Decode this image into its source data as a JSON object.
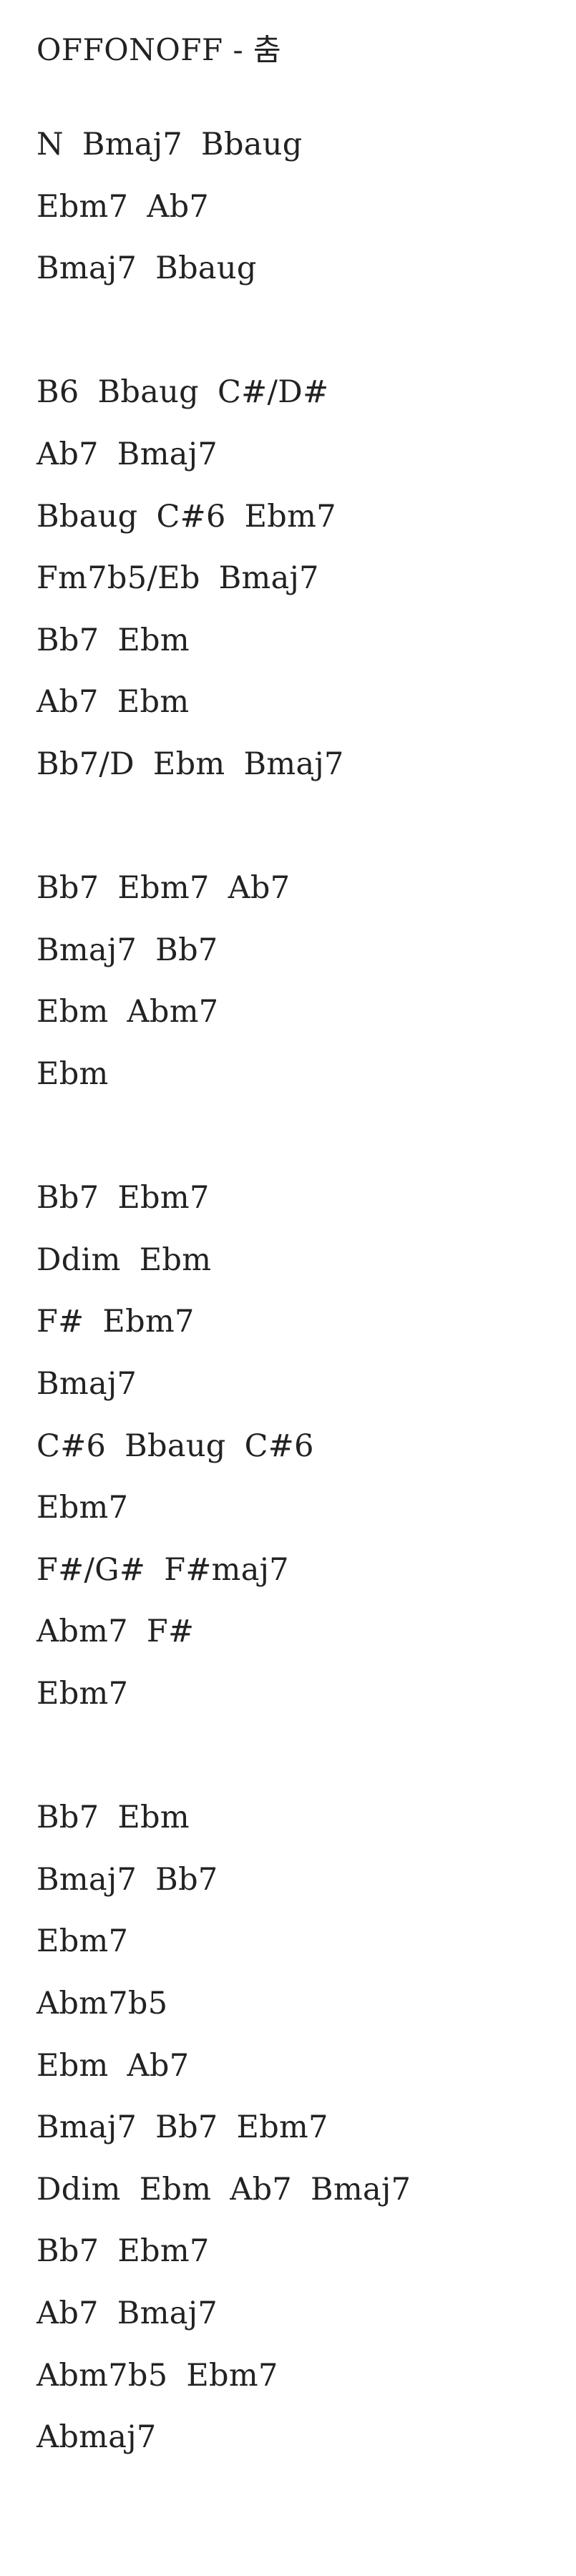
{
  "title": "OFFONOFF - 춤",
  "lines": [
    "N  Bmaj7  Bbaug",
    "Ebm7  Ab7",
    "Bmaj7  Bbaug",
    "",
    "B6  Bbaug  C#/D#",
    "Ab7  Bmaj7",
    "Bbaug  C#6  Ebm7",
    "Fm7b5/Eb  Bmaj7",
    "Bb7  Ebm",
    "Ab7  Ebm",
    "Bb7/D  Ebm  Bmaj7",
    "",
    "Bb7  Ebm7  Ab7",
    "Bmaj7  Bb7",
    "Ebm  Abm7",
    "Ebm",
    "",
    "Bb7  Ebm7",
    "Ddim  Ebm",
    "F#  Ebm7",
    "Bmaj7",
    "C#6  Bbaug  C#6",
    "Ebm7",
    "F#/G#  F#maj7",
    "Abm7  F#",
    "Ebm7",
    "",
    "Bb7  Ebm",
    "Bmaj7  Bb7",
    "Ebm7",
    "Abm7b5",
    "Ebm  Ab7",
    "Bmaj7  Bb7  Ebm7",
    "Ddim  Ebm  Ab7  Bmaj7",
    "Bb7  Ebm7",
    "Ab7  Bmaj7",
    "Abm7b5  Ebm7",
    "Abmaj7"
  ]
}
